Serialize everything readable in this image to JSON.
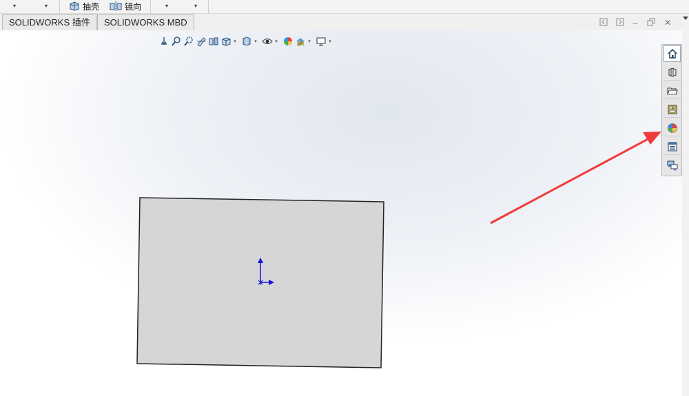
{
  "ribbon": {
    "shell_label": "抽壳",
    "mirror_label": "镜向"
  },
  "tabs": [
    {
      "label": "SOLIDWORKS 插件"
    },
    {
      "label": "SOLIDWORKS MBD"
    }
  ],
  "window_controls": {
    "minimize": "–",
    "restore": "🗗",
    "close": "✕"
  },
  "icons": {
    "hud": [
      "zoom-to-fit-icon",
      "zoom-to-area-icon",
      "previous-view-icon",
      "section-view-icon",
      "dynamic-annotation-icon",
      "view-orientation-icon",
      "display-style-icon",
      "hide-show-items-icon",
      "edit-appearance-icon",
      "apply-scene-icon",
      "view-settings-icon"
    ],
    "task_pane": [
      "home-icon",
      "design-library-icon",
      "file-explorer-icon",
      "view-palette-icon",
      "appearances-scenes-icon",
      "custom-properties-icon",
      "forum-icon"
    ]
  },
  "colors": {
    "arrow": "#ef3b3b",
    "sketch_fill": "#d6d6d6",
    "origin": "#1515d8"
  }
}
